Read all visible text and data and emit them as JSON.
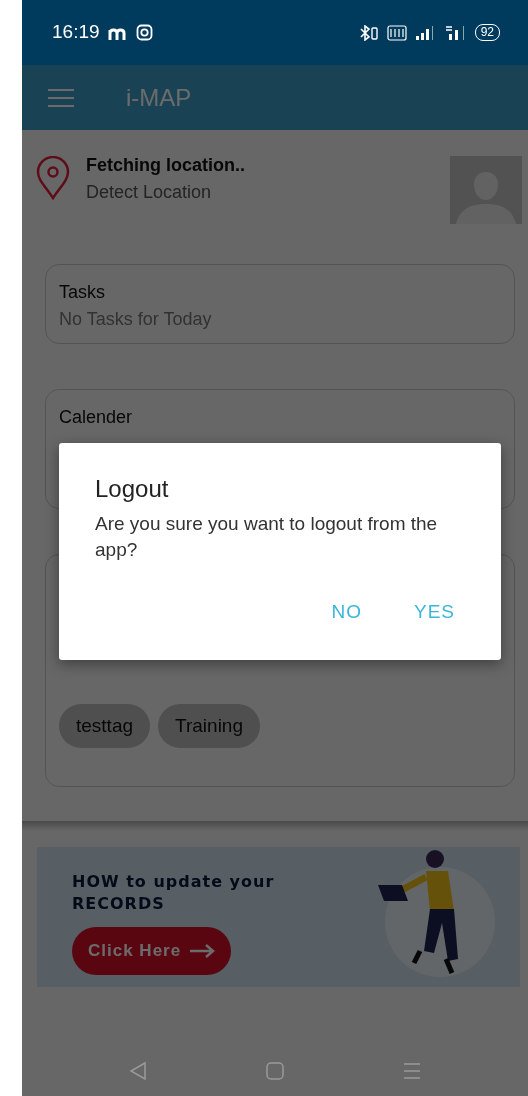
{
  "status_bar": {
    "time": "16:19",
    "battery": "92"
  },
  "app_bar": {
    "title": "i-MAP"
  },
  "location": {
    "title": "Fetching location..",
    "subtitle": "Detect Location"
  },
  "cards": [
    {
      "title": "Tasks",
      "subtitle": "No Tasks for Today"
    },
    {
      "title": "Calender"
    },
    {
      "tags": [
        "testtag",
        "Training"
      ]
    }
  ],
  "banner": {
    "headline": "HOW to update your RECORDS",
    "button": "Click Here"
  },
  "dialog": {
    "title": "Logout",
    "message": "Are you sure you want to logout from the app?",
    "buttons": [
      "NO",
      "YES"
    ]
  }
}
